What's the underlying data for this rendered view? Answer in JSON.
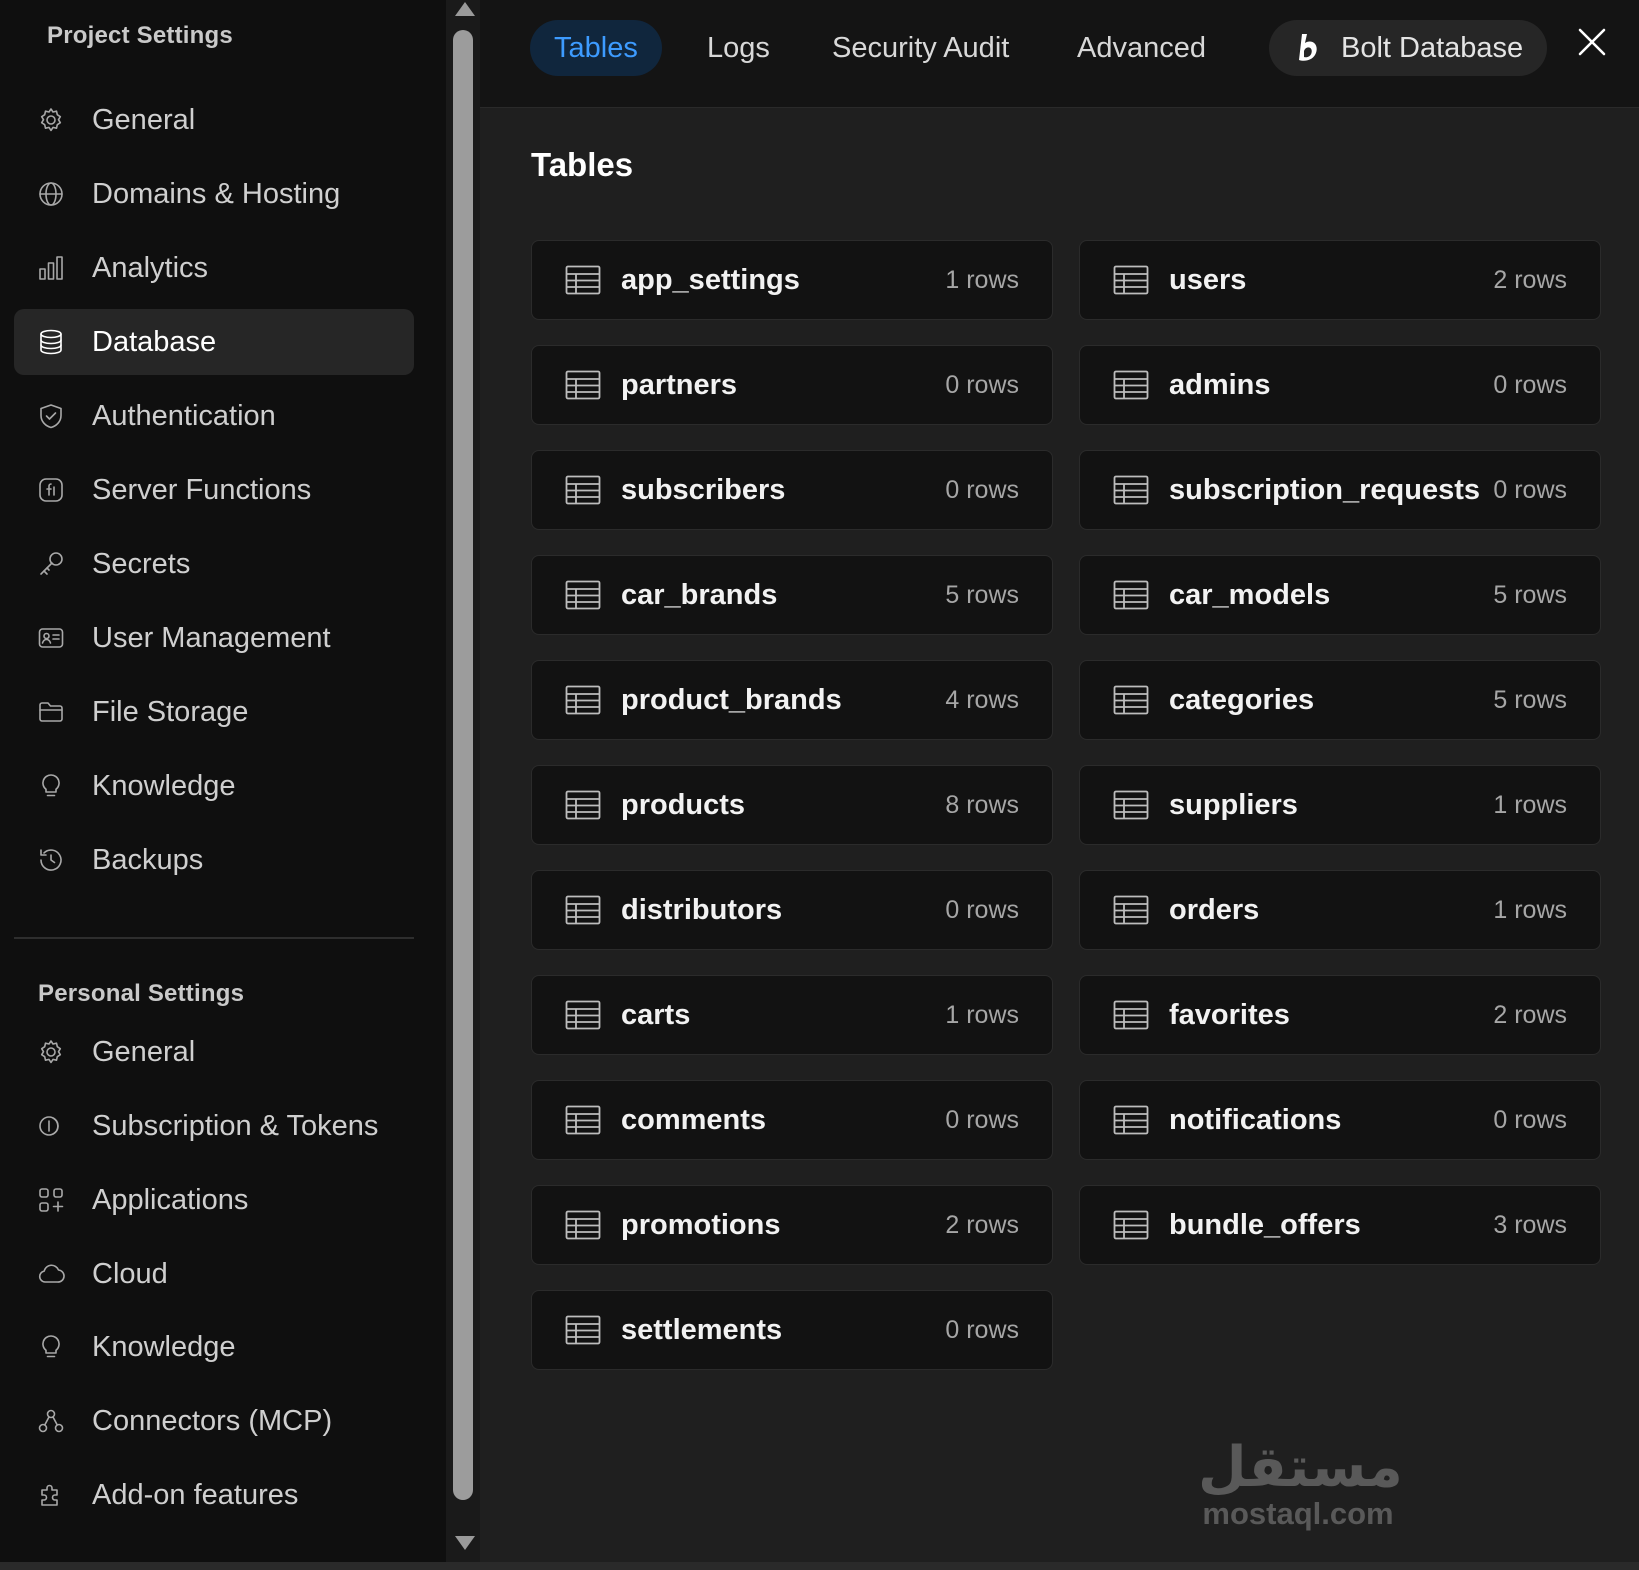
{
  "sidebar": {
    "project_title": "Project Settings",
    "personal_title": "Personal Settings",
    "project_items": [
      {
        "label": "General",
        "icon": "gear-icon"
      },
      {
        "label": "Domains & Hosting",
        "icon": "globe-icon"
      },
      {
        "label": "Analytics",
        "icon": "bar-chart-icon"
      },
      {
        "label": "Database",
        "icon": "database-icon",
        "active": true
      },
      {
        "label": "Authentication",
        "icon": "shield-icon"
      },
      {
        "label": "Server Functions",
        "icon": "function-icon"
      },
      {
        "label": "Secrets",
        "icon": "key-icon"
      },
      {
        "label": "User Management",
        "icon": "id-card-icon"
      },
      {
        "label": "File Storage",
        "icon": "folder-icon"
      },
      {
        "label": "Knowledge",
        "icon": "lightbulb-icon"
      },
      {
        "label": "Backups",
        "icon": "history-icon"
      }
    ],
    "personal_items": [
      {
        "label": "General",
        "icon": "gear-icon"
      },
      {
        "label": "Subscription & Tokens",
        "icon": "coins-icon"
      },
      {
        "label": "Applications",
        "icon": "apps-grid-icon"
      },
      {
        "label": "Cloud",
        "icon": "cloud-icon"
      },
      {
        "label": "Knowledge",
        "icon": "lightbulb-icon"
      },
      {
        "label": "Connectors (MCP)",
        "icon": "connectors-icon"
      },
      {
        "label": "Add-on features",
        "icon": "puzzle-icon"
      }
    ]
  },
  "tabs": [
    {
      "label": "Tables",
      "active": true
    },
    {
      "label": "Logs"
    },
    {
      "label": "Security Audit"
    },
    {
      "label": "Advanced"
    },
    {
      "label": "Bolt Database",
      "icon": "bolt-logo-icon"
    }
  ],
  "main": {
    "title": "Tables",
    "tables": [
      {
        "name": "app_settings",
        "rows": "1 rows"
      },
      {
        "name": "users",
        "rows": "2 rows"
      },
      {
        "name": "partners",
        "rows": "0 rows"
      },
      {
        "name": "admins",
        "rows": "0 rows"
      },
      {
        "name": "subscribers",
        "rows": "0 rows"
      },
      {
        "name": "subscription_requests",
        "rows": "0 rows"
      },
      {
        "name": "car_brands",
        "rows": "5 rows"
      },
      {
        "name": "car_models",
        "rows": "5 rows"
      },
      {
        "name": "product_brands",
        "rows": "4 rows"
      },
      {
        "name": "categories",
        "rows": "5 rows"
      },
      {
        "name": "products",
        "rows": "8 rows"
      },
      {
        "name": "suppliers",
        "rows": "1 rows"
      },
      {
        "name": "distributors",
        "rows": "0 rows"
      },
      {
        "name": "orders",
        "rows": "1 rows"
      },
      {
        "name": "carts",
        "rows": "1 rows"
      },
      {
        "name": "favorites",
        "rows": "2 rows"
      },
      {
        "name": "comments",
        "rows": "0 rows"
      },
      {
        "name": "notifications",
        "rows": "0 rows"
      },
      {
        "name": "promotions",
        "rows": "2 rows"
      },
      {
        "name": "bundle_offers",
        "rows": "3 rows"
      },
      {
        "name": "settlements",
        "rows": "0 rows"
      }
    ]
  },
  "watermark": {
    "logo": "مستقل",
    "text": "mostaql.com"
  },
  "colors": {
    "accent": "#3d9bff",
    "active_tab_bg": "#10263d",
    "sidebar_bg": "#0f0f0f",
    "main_bg": "#1f1f1f"
  }
}
